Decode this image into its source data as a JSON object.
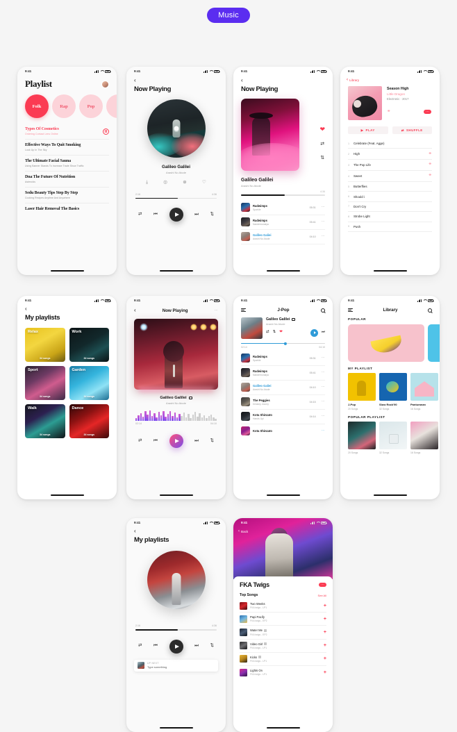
{
  "badge": {
    "label": "Music"
  },
  "status": {
    "time": "9:41"
  },
  "screens": {
    "playlist": {
      "title": "Playlist",
      "chips": [
        {
          "label": "Folk",
          "state": "active"
        },
        {
          "label": "Rap",
          "state": "dim"
        },
        {
          "label": "Pop",
          "state": "dim"
        }
      ],
      "items": [
        {
          "title": "Types Of Cosmetics",
          "sub": "Ordering Contact Lens Online",
          "featured": true
        },
        {
          "title": "Effective Ways To Quit Smoking",
          "sub": "Look Up In The Sky",
          "featured": false
        },
        {
          "title": "The Ultimate Facial Sauna",
          "sub": "Using Banner Stands To Increase Trade Show Traffic",
          "featured": false
        },
        {
          "title": "Dna The Future Of Nutrition",
          "sub": "Asteroids",
          "featured": false
        },
        {
          "title": "Sedu Beauty Tips Step By Step",
          "sub": "Cooking Recipes Anytime And Anywhere",
          "featured": false
        },
        {
          "title": "Laser Hair Removal The Basics",
          "sub": "",
          "featured": false
        }
      ]
    },
    "now_playing_disc": {
      "title": "Now Playing",
      "song": "Galileo Galilei",
      "album": "Arashi No Atode",
      "actions": [
        "download-icon",
        "airplay-icon",
        "add-icon",
        "heart-icon"
      ],
      "elapsed": "2:16",
      "duration": "4:36",
      "progress_pct": 52
    },
    "now_playing_pink": {
      "title": "Now Playing",
      "song": "Galileo Galilei",
      "album": "Arashi No Atode",
      "duration": "4:36",
      "progress_pct": 52,
      "side_icons": [
        "heart-icon",
        "shuffle-icon",
        "repeat-icon"
      ],
      "tracks": [
        {
          "name": "Radwimps",
          "sub": "Sparkle",
          "dur": "05:31",
          "active": false
        },
        {
          "name": "Radwimps",
          "sub": "Nandemonaiya",
          "dur": "05:41",
          "active": false
        },
        {
          "name": "Galileo Galiei",
          "sub": "Arashi No Atode",
          "dur": "04:10",
          "active": true
        }
      ]
    },
    "album": {
      "back_label": "Library",
      "name": "Season High",
      "artist": "Little Dragon",
      "genre": "Electronic · 2017",
      "play_label": "PLAY",
      "shuffle_label": "SHUFFLE",
      "songs": [
        {
          "n": "1",
          "name": "Celebrate (Feat. Agge)",
          "dl": false
        },
        {
          "n": "2",
          "name": "High",
          "dl": true
        },
        {
          "n": "3",
          "name": "The Pop Life",
          "dl": true
        },
        {
          "n": "4",
          "name": "Sweet",
          "dl": true
        },
        {
          "n": "5",
          "name": "Butterflies",
          "dl": false
        },
        {
          "n": "6",
          "name": "Should i",
          "dl": false
        },
        {
          "n": "7",
          "name": "Don't Cry",
          "dl": false
        },
        {
          "n": "8",
          "name": "Strobe Light",
          "dl": false
        },
        {
          "n": "9",
          "name": "Push",
          "dl": false
        }
      ]
    },
    "my_playlists_grid": {
      "title": "My playlists",
      "cards": [
        {
          "label": "Relax",
          "count": "34 songs",
          "cls": "c-relax"
        },
        {
          "label": "Work",
          "count": "34 songs",
          "cls": "c-work"
        },
        {
          "label": "Sport",
          "count": "34 songs",
          "cls": "c-sport"
        },
        {
          "label": "Garden",
          "count": "34 songs",
          "cls": "c-garden"
        },
        {
          "label": "Walk",
          "count": "34 songs",
          "cls": "c-walk"
        },
        {
          "label": "Dance",
          "count": "34 songs",
          "cls": "c-dance"
        }
      ]
    },
    "now_playing_wave": {
      "title": "Now Playing",
      "song": "Galileo Galilei",
      "album": "Arashi No Atode",
      "elapsed": "02:14",
      "duration": "04:10",
      "progress_pct": 53
    },
    "jpop": {
      "title": "J-Pop",
      "now": {
        "name": "Galileo Galilei",
        "sub": "Arashi No Atode",
        "elapsed": "02:14",
        "duration": "04:10",
        "progress_pct": 53
      },
      "tracks": [
        {
          "name": "Radwimps",
          "sub": "Sparkle",
          "dur": "05:31",
          "active": false
        },
        {
          "name": "Radwimps",
          "sub": "Nandemonaiya",
          "dur": "05:41",
          "active": false
        },
        {
          "name": "Galileo Galiei",
          "sub": "Arashi No Atode",
          "dur": "04:10",
          "active": true
        },
        {
          "name": "The Peggies",
          "sub": "Dreamy Journy",
          "dur": "04:15",
          "active": false
        },
        {
          "name": "Kota Shinzato",
          "sub": "Hands Up!",
          "dur": "04:14",
          "active": false
        },
        {
          "name": "Kota Shinzato",
          "sub": "",
          "dur": "",
          "active": false
        }
      ]
    },
    "library": {
      "title": "Library",
      "popular_label": "POPULAR",
      "my_playlist_label": "MY PLAYLIST",
      "popular_playlist_label": "POPULAR PLAYLIST",
      "my_playlists": [
        {
          "name": "J-Pop",
          "count": "20 Songs",
          "cls": "m1"
        },
        {
          "name": "Slow Rock'90",
          "count": "32 Songs",
          "cls": "m2"
        },
        {
          "name": "Panturanan",
          "count": "16 Songs",
          "cls": "m3"
        }
      ],
      "popular_playlists": [
        {
          "count": "20 Songs",
          "cls": "k1"
        },
        {
          "count": "32 Songs",
          "cls": "k2"
        },
        {
          "count": "16 Songs",
          "cls": "k3"
        }
      ]
    },
    "my_playlists_circle": {
      "title": "My playlists",
      "elapsed": "2:16",
      "duration": "4:36",
      "progress_pct": 52,
      "up_next_label": "UP NEXT",
      "up_next_value": "Type something"
    },
    "artist": {
      "back_label": "Back",
      "name": "FKA Twigs",
      "section_label": "Top Songs",
      "see_all": "See All",
      "songs": [
        {
          "name": "Two Weeks",
          "sub": "FKA twigs - LP1",
          "explicit": false,
          "cls": "t1"
        },
        {
          "name": "Papi Pacify",
          "sub": "FKA twigs - EP2",
          "explicit": false,
          "cls": "t2"
        },
        {
          "name": "Water Me",
          "sub": "FKA twigs - EP2",
          "explicit": true,
          "cls": "t3"
        },
        {
          "name": "Video Girl",
          "sub": "FKA twigs - LP1",
          "explicit": true,
          "cls": "t4"
        },
        {
          "name": "Kicks",
          "sub": "FKA twigs - LP1",
          "explicit": true,
          "cls": "t5"
        },
        {
          "name": "Lights On",
          "sub": "FKA twigs - LP1",
          "explicit": false,
          "cls": "t6"
        }
      ]
    }
  }
}
